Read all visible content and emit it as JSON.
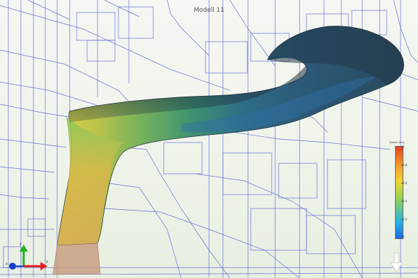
{
  "viewport": {
    "title": "Modell 11",
    "result_type": "velocity"
  },
  "legend": {
    "title": "Speed (m/s)",
    "ticks": [
      "1",
      "0.8",
      "0.6",
      "0.4",
      "0.2",
      "0"
    ]
  },
  "axis_triad": {
    "x_label": "x",
    "y_label": "y",
    "z_label": "z"
  },
  "colors": {
    "wireframe": "#3a42d8",
    "background": "#f1f5ed",
    "legend_low": "#1b6be0",
    "legend_high": "#e0431f",
    "axis_x": "#e02020",
    "axis_y": "#22b020",
    "axis_z": "#1840d0"
  },
  "icons": [
    "view-cube-arrow-icon",
    "axis-triad-icon"
  ]
}
